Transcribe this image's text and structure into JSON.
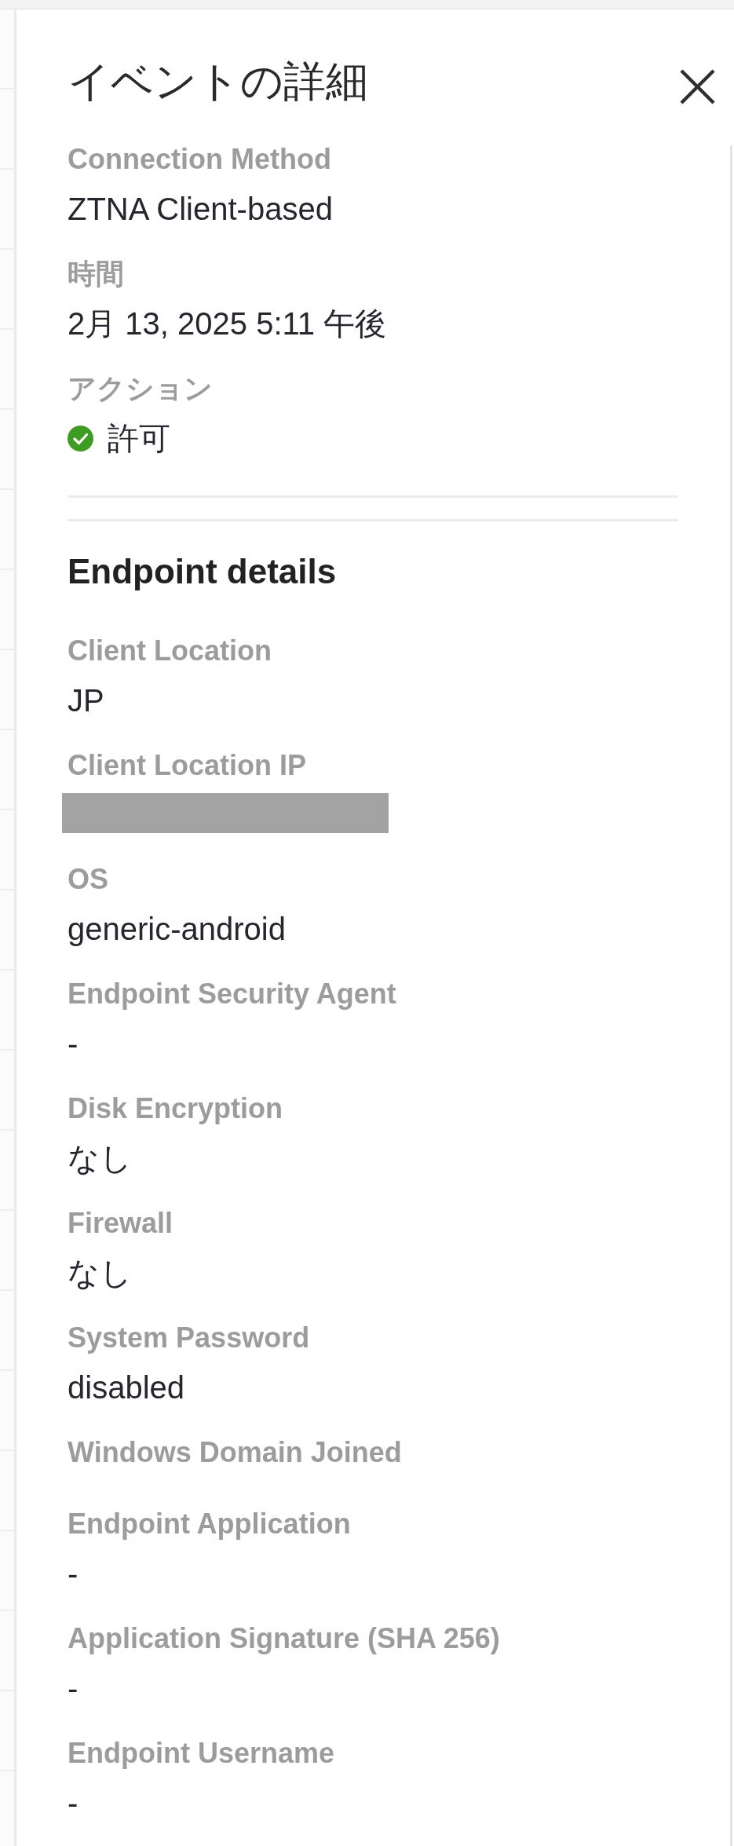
{
  "panel": {
    "title": "イベントの詳細"
  },
  "sections": [
    {
      "fields": [
        {
          "label": "Connection Method",
          "kind": "text",
          "value": "ZTNA Client-based"
        },
        {
          "label": "時間",
          "kind": "text",
          "value": "2月 13, 2025 5:11 午後"
        },
        {
          "label": "アクション",
          "kind": "status",
          "value": "許可"
        }
      ]
    },
    {
      "heading": "Endpoint details",
      "fields": [
        {
          "label": "Client Location",
          "kind": "text",
          "value": "JP"
        },
        {
          "label": "Client Location IP",
          "kind": "redacted"
        },
        {
          "label": "OS",
          "kind": "text",
          "value": "generic-android"
        },
        {
          "label": "Endpoint Security Agent",
          "kind": "text",
          "value": "-"
        },
        {
          "label": "Disk Encryption",
          "kind": "text",
          "value": "なし"
        },
        {
          "label": "Firewall",
          "kind": "text",
          "value": "なし"
        },
        {
          "label": "System Password",
          "kind": "text",
          "value": "disabled"
        },
        {
          "label": "Windows Domain Joined",
          "kind": "empty"
        },
        {
          "label": "Endpoint Application",
          "kind": "text",
          "value": "-"
        },
        {
          "label": "Application Signature (SHA 256)",
          "kind": "text",
          "value": "-"
        },
        {
          "label": "Endpoint Username",
          "kind": "text",
          "value": "-"
        }
      ]
    }
  ]
}
